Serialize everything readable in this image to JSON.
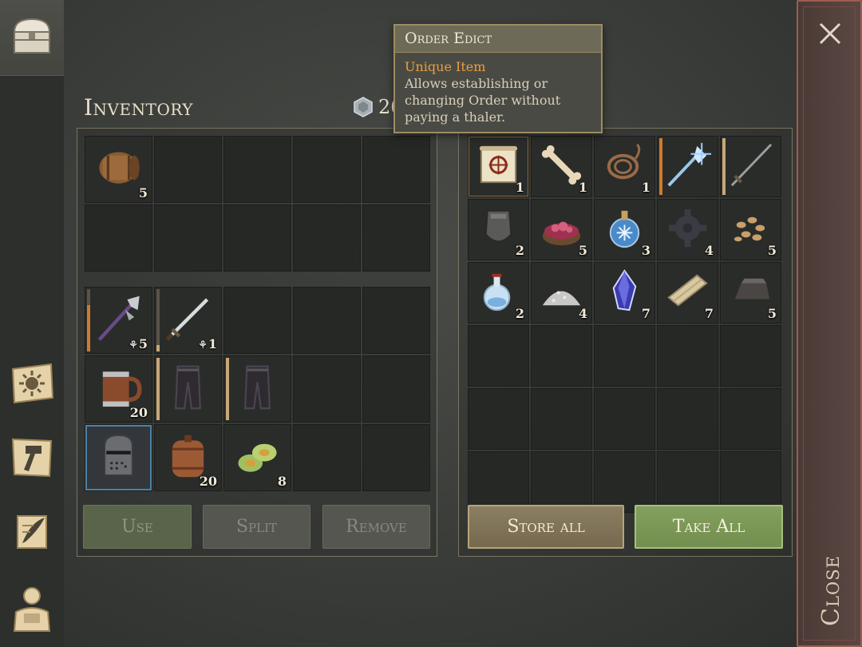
{
  "title": "Inventory",
  "currency": {
    "icon": "silver-coin-icon",
    "amount": "26"
  },
  "tooltip": {
    "title": "Order Edict",
    "rarity": "Unique Item",
    "description": "Allows establishing or changing Order without paying a thaler.",
    "rarity_color": "#e8a040"
  },
  "sidebar": [
    {
      "name": "chest-icon",
      "active": true
    },
    {
      "name": "sun-map-icon",
      "active": false
    },
    {
      "name": "crafting-hammer-icon",
      "active": false
    },
    {
      "name": "scroll-quill-icon",
      "active": false
    },
    {
      "name": "character-icon",
      "active": false
    }
  ],
  "close": {
    "label": "Close"
  },
  "left_top_grid": [
    {
      "icon": "barrel-icon",
      "count": "5"
    }
  ],
  "left_bottom_grid": [
    {
      "icon": "halberd-icon",
      "count": "5",
      "durability": true,
      "bar": 0.75,
      "bar_color": "orange"
    },
    {
      "icon": "sword-icon",
      "count": "1",
      "durability": true,
      "bar": 0.1,
      "bar_color": "tan"
    },
    null,
    null,
    null,
    {
      "icon": "tankard-icon",
      "count": "20"
    },
    {
      "icon": "leather-pants-icon",
      "count": "",
      "bar": 1.0,
      "bar_color": "tan"
    },
    {
      "icon": "leather-pants-icon",
      "count": "",
      "bar": 1.0,
      "bar_color": "tan"
    },
    null,
    null,
    {
      "icon": "knight-helmet-icon",
      "count": "",
      "selected": true
    },
    {
      "icon": "keg-icon",
      "count": "20"
    },
    {
      "icon": "cabbage-icon",
      "count": "8"
    },
    null,
    null
  ],
  "storage_grid": [
    {
      "icon": "order-edict-scroll-icon",
      "count": "1",
      "highlight": true
    },
    {
      "icon": "bone-icon",
      "count": "1"
    },
    {
      "icon": "rope-icon",
      "count": "1"
    },
    {
      "icon": "ice-spear-icon",
      "count": "",
      "bar": 1.0,
      "bar_color": "orange"
    },
    {
      "icon": "rapier-icon",
      "count": "",
      "bar": 1.0,
      "bar_color": "tan"
    },
    {
      "icon": "iron-plate-icon",
      "count": "2"
    },
    {
      "icon": "meat-bowl-icon",
      "count": "5"
    },
    {
      "icon": "frost-potion-icon",
      "count": "3"
    },
    {
      "icon": "gear-icon",
      "count": "4"
    },
    {
      "icon": "seeds-icon",
      "count": "5"
    },
    {
      "icon": "potion-flask-icon",
      "count": "2"
    },
    {
      "icon": "salt-pile-icon",
      "count": "4"
    },
    {
      "icon": "crystal-icon",
      "count": "7"
    },
    {
      "icon": "planks-icon",
      "count": "7"
    },
    {
      "icon": "iron-ingot-icon",
      "count": "5"
    }
  ],
  "buttons": {
    "use": "Use",
    "split": "Split",
    "remove": "Remove",
    "store_all": "Store all",
    "take_all": "Take All"
  }
}
